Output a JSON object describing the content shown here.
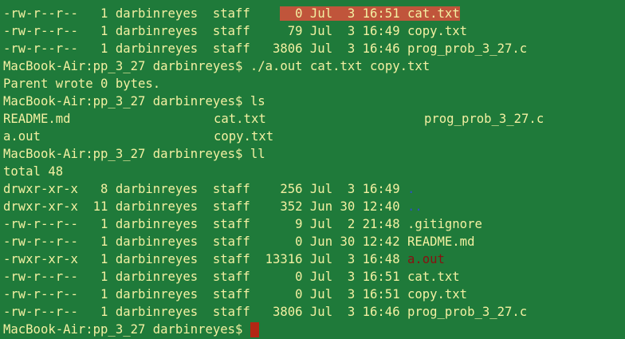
{
  "terminal": {
    "top_listing": [
      {
        "perms": "-rw-r--r--",
        "links": "1",
        "owner": "darbinreyes",
        "group": "staff",
        "size": "0",
        "month": "Jul",
        "day": "3",
        "time": "16:51",
        "name": "cat.txt",
        "highlight": true
      },
      {
        "perms": "-rw-r--r--",
        "links": "1",
        "owner": "darbinreyes",
        "group": "staff",
        "size": "79",
        "month": "Jul",
        "day": "3",
        "time": "16:49",
        "name": "copy.txt",
        "highlight": false
      },
      {
        "perms": "-rw-r--r--",
        "links": "1",
        "owner": "darbinreyes",
        "group": "staff",
        "size": "3806",
        "month": "Jul",
        "day": "3",
        "time": "16:46",
        "name": "prog_prob_3_27.c",
        "highlight": false
      }
    ],
    "prompt": "MacBook-Air:pp_3_27 darbinreyes$",
    "cmd1": "./a.out cat.txt copy.txt",
    "out1": "Parent wrote 0 bytes.",
    "cmd2": "ls",
    "ls_row1": [
      "README.md",
      "cat.txt",
      "prog_prob_3_27.c"
    ],
    "ls_row2": [
      "a.out",
      "copy.txt"
    ],
    "cmd3": "ll",
    "total": "total 48",
    "ll_listing": [
      {
        "perms": "drwxr-xr-x",
        "links": "8",
        "owner": "darbinreyes",
        "group": "staff",
        "size": "256",
        "month": "Jul",
        "day": "3",
        "time": "16:49",
        "name": ".",
        "kind": "dir"
      },
      {
        "perms": "drwxr-xr-x",
        "links": "11",
        "owner": "darbinreyes",
        "group": "staff",
        "size": "352",
        "month": "Jun",
        "day": "30",
        "time": "12:40",
        "name": "..",
        "kind": "dir"
      },
      {
        "perms": "-rw-r--r--",
        "links": "1",
        "owner": "darbinreyes",
        "group": "staff",
        "size": "9",
        "month": "Jul",
        "day": "2",
        "time": "21:48",
        "name": ".gitignore",
        "kind": "file"
      },
      {
        "perms": "-rw-r--r--",
        "links": "1",
        "owner": "darbinreyes",
        "group": "staff",
        "size": "0",
        "month": "Jun",
        "day": "30",
        "time": "12:42",
        "name": "README.md",
        "kind": "file"
      },
      {
        "perms": "-rwxr-xr-x",
        "links": "1",
        "owner": "darbinreyes",
        "group": "staff",
        "size": "13316",
        "month": "Jul",
        "day": "3",
        "time": "16:48",
        "name": "a.out",
        "kind": "exe"
      },
      {
        "perms": "-rw-r--r--",
        "links": "1",
        "owner": "darbinreyes",
        "group": "staff",
        "size": "0",
        "month": "Jul",
        "day": "3",
        "time": "16:51",
        "name": "cat.txt",
        "kind": "file"
      },
      {
        "perms": "-rw-r--r--",
        "links": "1",
        "owner": "darbinreyes",
        "group": "staff",
        "size": "0",
        "month": "Jul",
        "day": "3",
        "time": "16:51",
        "name": "copy.txt",
        "kind": "file"
      },
      {
        "perms": "-rw-r--r--",
        "links": "1",
        "owner": "darbinreyes",
        "group": "staff",
        "size": "3806",
        "month": "Jul",
        "day": "3",
        "time": "16:46",
        "name": "prog_prob_3_27.c",
        "kind": "file"
      }
    ]
  },
  "colors": {
    "background": "#1f7a3a",
    "text": "#f3f0a2",
    "selection": "#c0553b",
    "directory": "#2d4fc4",
    "executable": "#8a1010",
    "cursor": "#b32714"
  }
}
